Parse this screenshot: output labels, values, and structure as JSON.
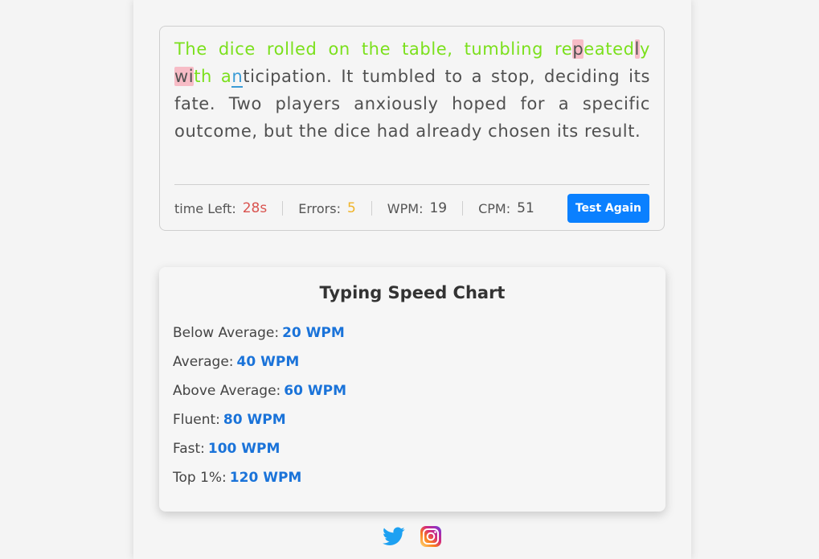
{
  "typing_test": {
    "segments": [
      {
        "text": "The dice rolled on the table, tumbling re",
        "state": "correct"
      },
      {
        "text": "p",
        "state": "wrong"
      },
      {
        "text": "eated",
        "state": "correct"
      },
      {
        "text": "l",
        "state": "wrong"
      },
      {
        "text": "y ",
        "state": "correct"
      },
      {
        "text": "wi",
        "state": "wrong"
      },
      {
        "text": "th a",
        "state": "correct"
      },
      {
        "text": "n",
        "state": "active"
      },
      {
        "text": "ticipation. It tumbled to a stop, deciding its fate. Two players anxiously hoped for a specific outcome, but the dice had already chosen its result.",
        "state": "pending"
      }
    ],
    "stats": {
      "time_label": "time Left:",
      "time_value": "28s",
      "errors_label": "Errors:",
      "errors_value": "5",
      "wpm_label": "WPM:",
      "wpm_value": "19",
      "cpm_label": "CPM:",
      "cpm_value": "51"
    },
    "test_again_label": "Test Again"
  },
  "speed_chart": {
    "title": "Typing Speed Chart",
    "levels": [
      {
        "label": "Below Average:",
        "speed": "20 WPM"
      },
      {
        "label": "Average:",
        "speed": "40 WPM"
      },
      {
        "label": "Above Average:",
        "speed": "60 WPM"
      },
      {
        "label": "Fluent:",
        "speed": "80 WPM"
      },
      {
        "label": "Fast:",
        "speed": "100 WPM"
      },
      {
        "label": "Top 1%:",
        "speed": "120 WPM"
      }
    ]
  },
  "social": {
    "icons": [
      "twitter-icon",
      "instagram-icon"
    ],
    "twitter_color": "#1da1f2"
  },
  "colors": {
    "correct": "#7be01c",
    "wrong_bg": "#f7bcc6",
    "accent": "#0a80ff",
    "time": "#d9534f",
    "errors": "#f0b429"
  }
}
